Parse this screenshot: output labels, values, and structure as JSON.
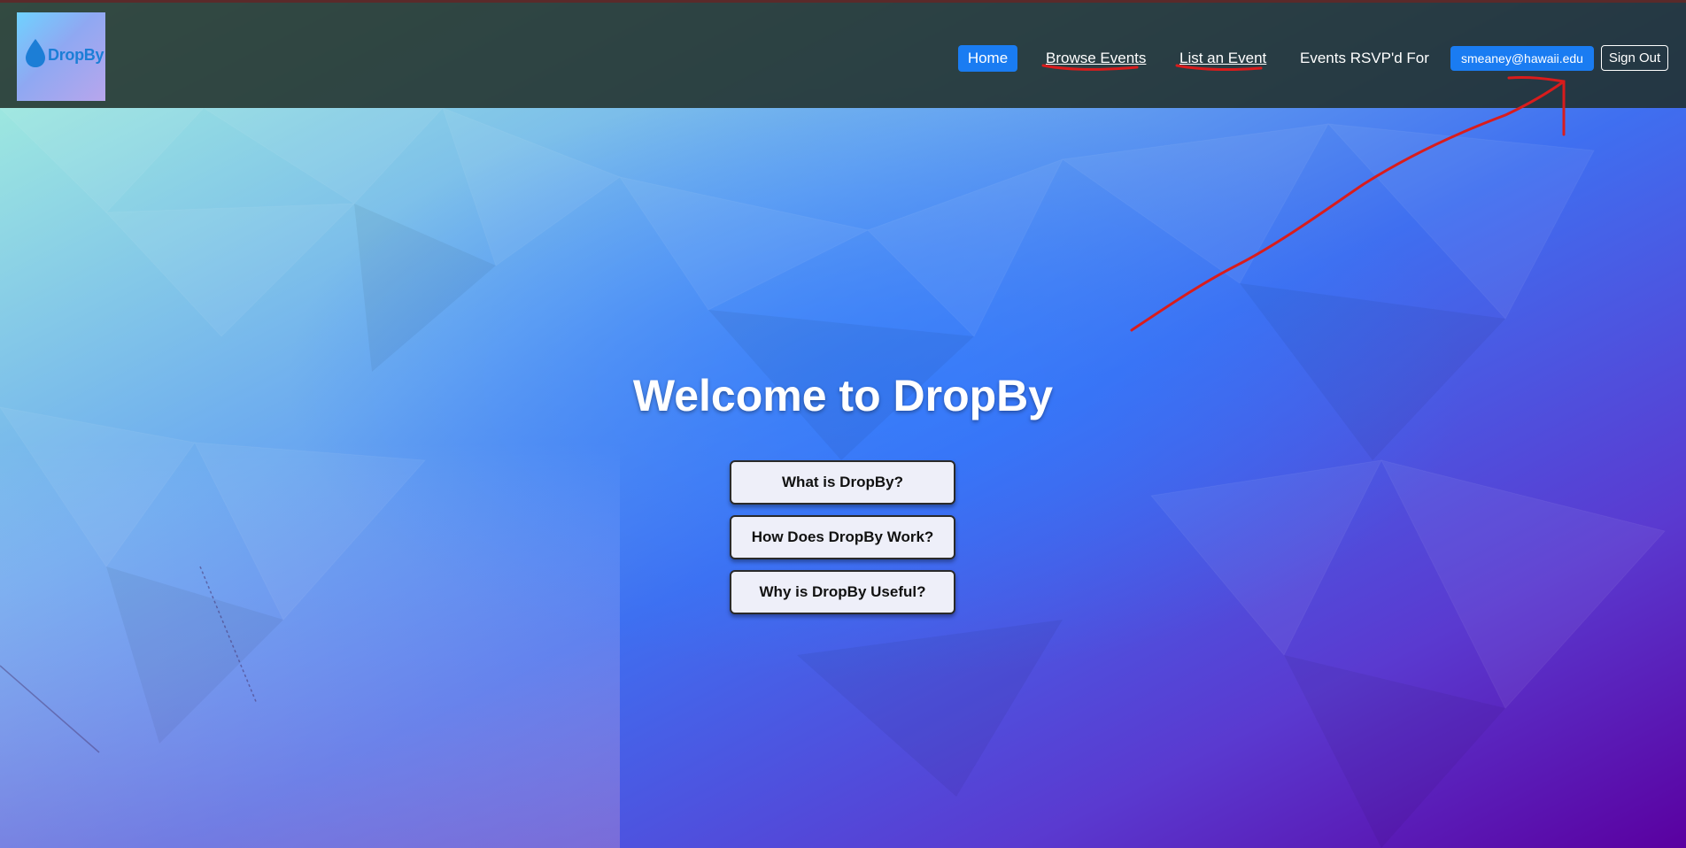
{
  "brand": {
    "logo_text": "DropBy",
    "logo_icon": "water-drop-icon"
  },
  "nav": {
    "home": "Home",
    "browse_events": "Browse Events",
    "list_event": "List an Event",
    "events_rsvpd": "Events RSVP'd For",
    "user_email": "smeaney@hawaii.edu",
    "sign_out": "Sign Out"
  },
  "hero": {
    "title": "Welcome to DropBy",
    "buttons": [
      "What is DropBy?",
      "How Does DropBy Work?",
      "Why is DropBy Useful?"
    ]
  },
  "colors": {
    "nav_active": "#1a7cf2",
    "annotation_red": "#d91c1c",
    "navbar_bg": "#202d28"
  }
}
